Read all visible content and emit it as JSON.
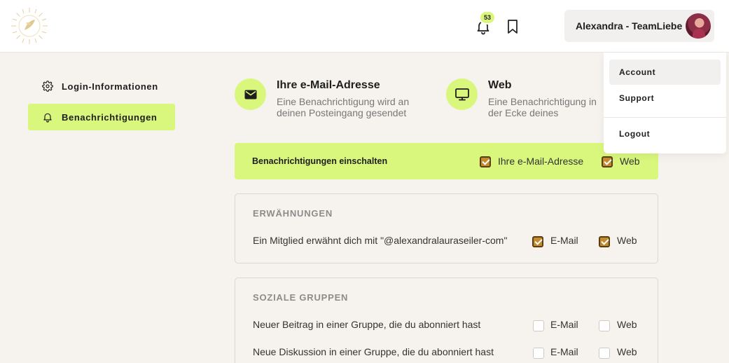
{
  "header": {
    "notification_count": "53",
    "user_name": "Alexandra - TeamLiebe"
  },
  "sidebar": {
    "items": [
      {
        "label": "Login-Informationen",
        "icon": "gear-icon"
      },
      {
        "label": "Benachrichtigungen",
        "icon": "bell-icon",
        "active": true
      }
    ]
  },
  "channels": [
    {
      "title": "Ihre e-Mail-Adresse",
      "description": "Eine Benachrichtigung wird an deinen Posteingang gesendet",
      "icon": "envelope-icon"
    },
    {
      "title": "Web",
      "description": "Eine Benachrichtigung in der Ecke deines Bildschirms",
      "icon": "monitor-icon"
    }
  ],
  "enable_bar": {
    "label": "Benachrichtigungen einschalten",
    "options": [
      {
        "label": "Ihre e-Mail-Adresse",
        "checked": true
      },
      {
        "label": "Web",
        "checked": true
      }
    ]
  },
  "sections": [
    {
      "title": "ERWÄHNUNGEN",
      "rows": [
        {
          "label": "Ein Mitglied erwähnt dich mit \"@alexandralauraseiler-com\"",
          "email_label": "E-Mail",
          "web_label": "Web",
          "email": true,
          "web": true
        }
      ]
    },
    {
      "title": "SOZIALE GRUPPEN",
      "rows": [
        {
          "label": "Neuer Beitrag in einer Gruppe, die du abonniert hast",
          "email_label": "E-Mail",
          "web_label": "Web",
          "email": false,
          "web": false
        },
        {
          "label": "Neue Diskussion in einer Gruppe, die du abonniert hast",
          "email_label": "E-Mail",
          "web_label": "Web",
          "email": false,
          "web": false
        }
      ]
    }
  ],
  "dropdown": {
    "items": [
      "Account",
      "Support",
      "Logout"
    ]
  },
  "colors": {
    "accent": "#d9f77c",
    "checkbox_checked": "#c48b2e",
    "background": "#f6f3ee"
  }
}
